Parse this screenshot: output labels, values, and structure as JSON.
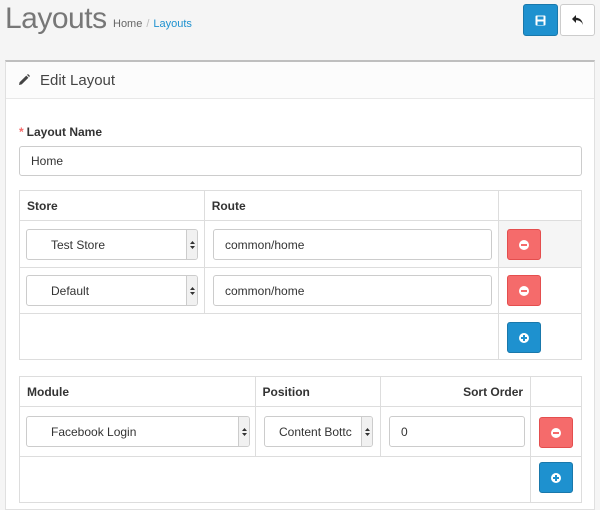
{
  "header": {
    "title": "Layouts",
    "breadcrumb": [
      "Home",
      "Layouts"
    ],
    "breadcrumb_sep": "/"
  },
  "panel": {
    "title": "Edit Layout"
  },
  "form": {
    "layout_name_label": "Layout Name",
    "required_mark": "*",
    "layout_name_value": "Home"
  },
  "routes": {
    "headers": [
      "Store",
      "Route"
    ],
    "rows": [
      {
        "store": "Test Store",
        "route": "common/home"
      },
      {
        "store": "Default",
        "route": "common/home"
      }
    ]
  },
  "modules": {
    "headers": [
      "Module",
      "Position",
      "Sort Order"
    ],
    "rows": [
      {
        "module": "Facebook Login",
        "position": "Content Bottc",
        "sort_order": "0"
      }
    ]
  },
  "colors": {
    "primary": "#1e91cf",
    "danger": "#f56b6b",
    "required": "#f56b6b"
  },
  "icons": {
    "save": "floppy-disk-icon",
    "back": "reply-arrow-icon",
    "edit": "pencil-icon",
    "remove": "minus-circle-icon",
    "add": "plus-circle-icon"
  }
}
